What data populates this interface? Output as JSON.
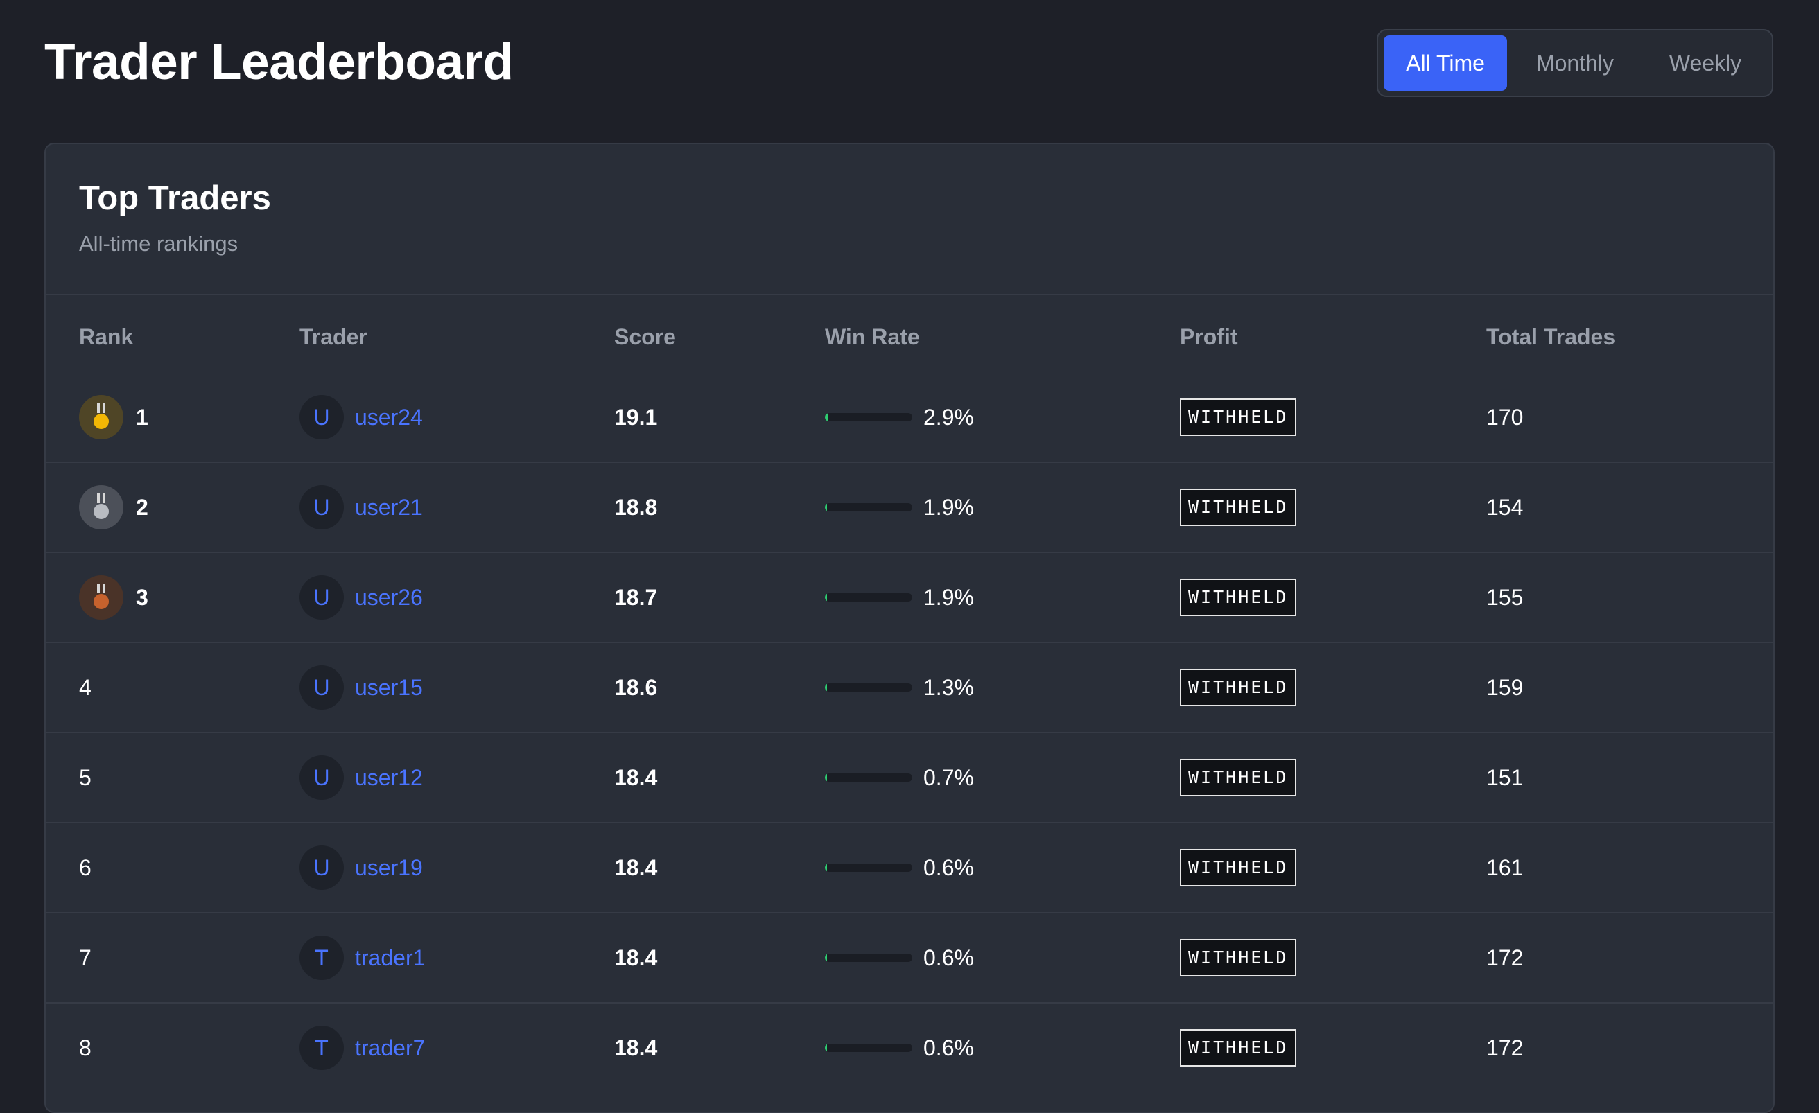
{
  "header": {
    "title": "Trader Leaderboard"
  },
  "period_toggle": {
    "options": [
      "All Time",
      "Monthly",
      "Weekly"
    ],
    "selected": "All Time"
  },
  "panel": {
    "title": "Top Traders",
    "subtitle": "All-time rankings"
  },
  "table": {
    "columns": [
      "Rank",
      "Trader",
      "Score",
      "Win Rate",
      "Profit",
      "Total Trades"
    ],
    "rows": [
      {
        "rank": "1",
        "medal": "gold",
        "initial": "U",
        "name": "user24",
        "score": "19.1",
        "win_rate": "2.9%",
        "win_rate_value": 0.029,
        "profit": "WITHHELD",
        "total_trades": "170"
      },
      {
        "rank": "2",
        "medal": "silver",
        "initial": "U",
        "name": "user21",
        "score": "18.8",
        "win_rate": "1.9%",
        "win_rate_value": 0.019,
        "profit": "WITHHELD",
        "total_trades": "154"
      },
      {
        "rank": "3",
        "medal": "bronze",
        "initial": "U",
        "name": "user26",
        "score": "18.7",
        "win_rate": "1.9%",
        "win_rate_value": 0.019,
        "profit": "WITHHELD",
        "total_trades": "155"
      },
      {
        "rank": "4",
        "medal": "",
        "initial": "U",
        "name": "user15",
        "score": "18.6",
        "win_rate": "1.3%",
        "win_rate_value": 0.013,
        "profit": "WITHHELD",
        "total_trades": "159"
      },
      {
        "rank": "5",
        "medal": "",
        "initial": "U",
        "name": "user12",
        "score": "18.4",
        "win_rate": "0.7%",
        "win_rate_value": 0.007,
        "profit": "WITHHELD",
        "total_trades": "151"
      },
      {
        "rank": "6",
        "medal": "",
        "initial": "U",
        "name": "user19",
        "score": "18.4",
        "win_rate": "0.6%",
        "win_rate_value": 0.006,
        "profit": "WITHHELD",
        "total_trades": "161"
      },
      {
        "rank": "7",
        "medal": "",
        "initial": "T",
        "name": "trader1",
        "score": "18.4",
        "win_rate": "0.6%",
        "win_rate_value": 0.006,
        "profit": "WITHHELD",
        "total_trades": "172"
      },
      {
        "rank": "8",
        "medal": "",
        "initial": "T",
        "name": "trader7",
        "score": "18.4",
        "win_rate": "0.6%",
        "win_rate_value": 0.006,
        "profit": "WITHHELD",
        "total_trades": "172"
      }
    ]
  },
  "colors": {
    "accent": "#3a63f7",
    "link": "#4a74ff",
    "win_fill": "#2ecc71",
    "gold": "#f2b705",
    "silver": "#b9bcc2",
    "bronze": "#c7622d"
  },
  "icons": {
    "medal_1": "gold-medal-icon",
    "medal_2": "silver-medal-icon",
    "medal_3": "bronze-medal-icon"
  }
}
